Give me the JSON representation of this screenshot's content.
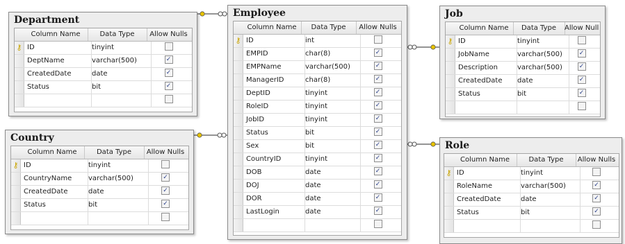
{
  "headers": {
    "column_name": "Column Name",
    "data_type": "Data Type",
    "allow_nulls": "Allow Nulls"
  },
  "tables": {
    "department": {
      "title": "Department",
      "rows": [
        {
          "name": "ID",
          "type": "tinyint",
          "nulls": false,
          "key": true
        },
        {
          "name": "DeptName",
          "type": "varchar(500)",
          "nulls": true
        },
        {
          "name": "CreatedDate",
          "type": "date",
          "nulls": true
        },
        {
          "name": "Status",
          "type": "bit",
          "nulls": true
        }
      ]
    },
    "country": {
      "title": "Country",
      "rows": [
        {
          "name": "ID",
          "type": "tinyint",
          "nulls": false,
          "key": true
        },
        {
          "name": "CountryName",
          "type": "varchar(500)",
          "nulls": true
        },
        {
          "name": "CreatedDate",
          "type": "date",
          "nulls": true
        },
        {
          "name": "Status",
          "type": "bit",
          "nulls": true
        }
      ]
    },
    "employee": {
      "title": "Employee",
      "rows": [
        {
          "name": "ID",
          "type": "int",
          "nulls": false,
          "key": true
        },
        {
          "name": "EMPID",
          "type": "char(8)",
          "nulls": true
        },
        {
          "name": "EMPName",
          "type": "varchar(500)",
          "nulls": true
        },
        {
          "name": "ManagerID",
          "type": "char(8)",
          "nulls": true
        },
        {
          "name": "DeptID",
          "type": "tinyint",
          "nulls": true
        },
        {
          "name": "RoleID",
          "type": "tinyint",
          "nulls": true
        },
        {
          "name": "JobID",
          "type": "tinyint",
          "nulls": true
        },
        {
          "name": "Status",
          "type": "bit",
          "nulls": true
        },
        {
          "name": "Sex",
          "type": "bit",
          "nulls": true
        },
        {
          "name": "CountryID",
          "type": "tinyint",
          "nulls": true
        },
        {
          "name": "DOB",
          "type": "date",
          "nulls": true
        },
        {
          "name": "DOJ",
          "type": "date",
          "nulls": true
        },
        {
          "name": "DOR",
          "type": "date",
          "nulls": true
        },
        {
          "name": "LastLogin",
          "type": "date",
          "nulls": true
        }
      ]
    },
    "job": {
      "title": "Job",
      "rows": [
        {
          "name": "ID",
          "type": "tinyint",
          "nulls": false,
          "key": true
        },
        {
          "name": "JobName",
          "type": "varchar(500)",
          "nulls": true
        },
        {
          "name": "Description",
          "type": "varchar(500)",
          "nulls": true
        },
        {
          "name": "CreatedDate",
          "type": "date",
          "nulls": true
        },
        {
          "name": "Status",
          "type": "bit",
          "nulls": true
        }
      ]
    },
    "role": {
      "title": "Role",
      "rows": [
        {
          "name": "ID",
          "type": "tinyint",
          "nulls": false,
          "key": true
        },
        {
          "name": "RoleName",
          "type": "varchar(500)",
          "nulls": true
        },
        {
          "name": "CreatedDate",
          "type": "date",
          "nulls": true
        },
        {
          "name": "Status",
          "type": "bit",
          "nulls": true
        }
      ]
    }
  },
  "icons": {
    "primary_key": "key-icon",
    "relationship": "relationship-connector-icon"
  },
  "colors": {
    "key": "#c9a400",
    "check": "#2a3f8a",
    "connector": "#555555"
  }
}
